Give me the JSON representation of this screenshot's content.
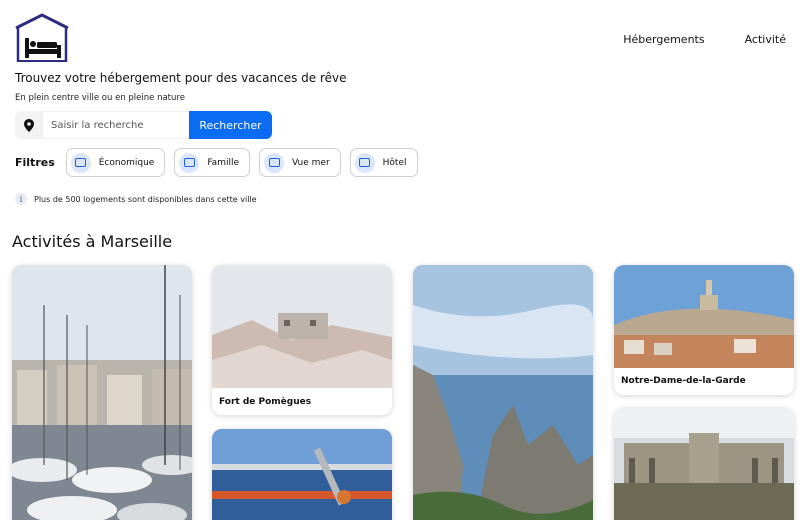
{
  "nav": {
    "items": [
      "Hébergements",
      "Activité"
    ]
  },
  "hero": {
    "title": "Trouvez votre hébergement pour des vacances de rêve",
    "subtitle": "En plein centre ville ou en pleine nature"
  },
  "search": {
    "placeholder": "Saisir la recherche",
    "button_label": "Rechercher"
  },
  "filters": {
    "label": "Filtres",
    "chips": [
      "Économique",
      "Famille",
      "Vue mer",
      "Hôtel"
    ]
  },
  "info": {
    "text": "Plus de 500 logements sont disponibles dans cette ville"
  },
  "activities": {
    "title": "Activités à Marseille",
    "cards": [
      {
        "caption": ""
      },
      {
        "caption": "Fort de Pomègues"
      },
      {
        "caption": ""
      },
      {
        "caption": ""
      },
      {
        "caption": "Notre-Dame-de-la-Garde"
      },
      {
        "caption": ""
      }
    ]
  },
  "colors": {
    "accent": "#0a6cf2",
    "logo": "#2b2b80",
    "chip_icon": "#1e5fd8"
  }
}
